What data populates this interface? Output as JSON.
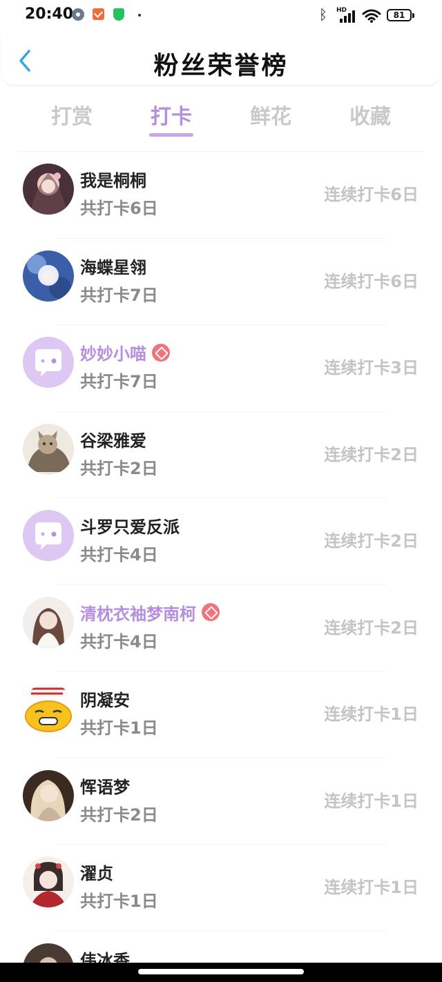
{
  "status_bar": {
    "time": "20:40",
    "hd_label": "HD",
    "battery": "81",
    "icons": [
      "settings-icon",
      "mail-icon",
      "shield-icon",
      "bluetooth-icon",
      "signal-icon",
      "wifi-icon",
      "battery-icon"
    ]
  },
  "header": {
    "title": "粉丝荣誉榜",
    "back_icon": "chevron-left-icon"
  },
  "tabs": [
    {
      "label": "打赏",
      "active": false
    },
    {
      "label": "打卡",
      "active": true
    },
    {
      "label": "鲜花",
      "active": false
    },
    {
      "label": "收藏",
      "active": false
    }
  ],
  "colors": {
    "accent": "#b58ee0",
    "vip_badge": "#f0747e",
    "placeholder_avatar": "#dcc8f2"
  },
  "fans": [
    {
      "name": "我是桐桐",
      "total": "共打卡6日",
      "streak": "连续打卡6日",
      "vip": false,
      "avatar": "photo"
    },
    {
      "name": "海蝶星翎",
      "total": "共打卡7日",
      "streak": "连续打卡6日",
      "vip": false,
      "avatar": "photo"
    },
    {
      "name": "妙妙小喵",
      "total": "共打卡7日",
      "streak": "连续打卡3日",
      "vip": true,
      "avatar": "default-chat"
    },
    {
      "name": "谷梁雅爱",
      "total": "共打卡2日",
      "streak": "连续打卡2日",
      "vip": false,
      "avatar": "photo"
    },
    {
      "name": "斗罗只爱反派",
      "total": "共打卡4日",
      "streak": "连续打卡2日",
      "vip": false,
      "avatar": "default-chat"
    },
    {
      "name": "清枕衣袖梦南柯",
      "total": "共打卡4日",
      "streak": "连续打卡2日",
      "vip": true,
      "avatar": "photo"
    },
    {
      "name": "阴凝安",
      "total": "共打卡1日",
      "streak": "连续打卡1日",
      "vip": false,
      "avatar": "emoji-face"
    },
    {
      "name": "恽语梦",
      "total": "共打卡2日",
      "streak": "连续打卡1日",
      "vip": false,
      "avatar": "photo"
    },
    {
      "name": "濯贞",
      "total": "共打卡1日",
      "streak": "连续打卡1日",
      "vip": false,
      "avatar": "photo"
    },
    {
      "name": "伟冰香",
      "total": "",
      "streak": "",
      "vip": false,
      "avatar": "photo"
    }
  ]
}
